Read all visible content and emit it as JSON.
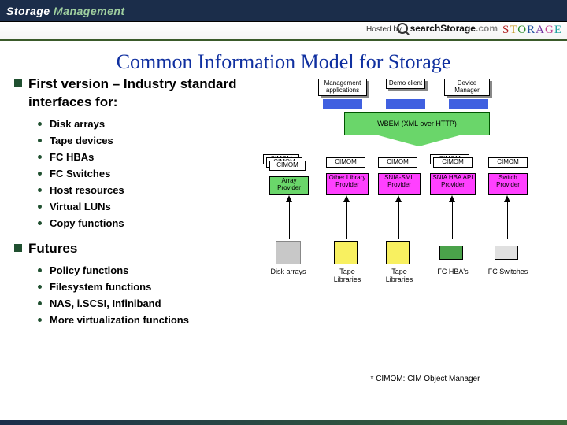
{
  "header": {
    "brand_a": "Storage",
    "brand_b": "Management",
    "hosted_by": "Hosted by",
    "search_brand_a": "search",
    "search_brand_b": "Storage",
    "search_brand_c": ".com",
    "storage_logo": "STORAGE"
  },
  "title": "Common Information Model for Storage",
  "sections": [
    {
      "heading": "First version – Industry standard interfaces for:",
      "items": [
        "Disk arrays",
        "Tape devices",
        "FC HBAs",
        "FC Switches",
        "Host resources",
        "Virtual LUNs",
        "Copy functions"
      ]
    },
    {
      "heading": "Futures",
      "items": [
        "Policy functions",
        "Filesystem functions",
        "NAS, i.SCSI, Infiniband",
        "More virtualization functions"
      ]
    }
  ],
  "diagram": {
    "top_boxes": [
      "Management applications",
      "Demo client",
      "Device Manager"
    ],
    "arrow_label": "WBEM (XML over HTTP)",
    "cimom": "CIMOM",
    "providers": [
      "Array Provider",
      "Other Library Provider",
      "SNIA-SML Provider",
      "SNIA HBA API Provider",
      "Switch Provider"
    ],
    "bottom_labels": [
      "Disk arrays",
      "Tape Libraries",
      "Tape Libraries",
      "FC HBA's",
      "FC Switches"
    ]
  },
  "footnote": "* CIMOM: CIM Object Manager"
}
